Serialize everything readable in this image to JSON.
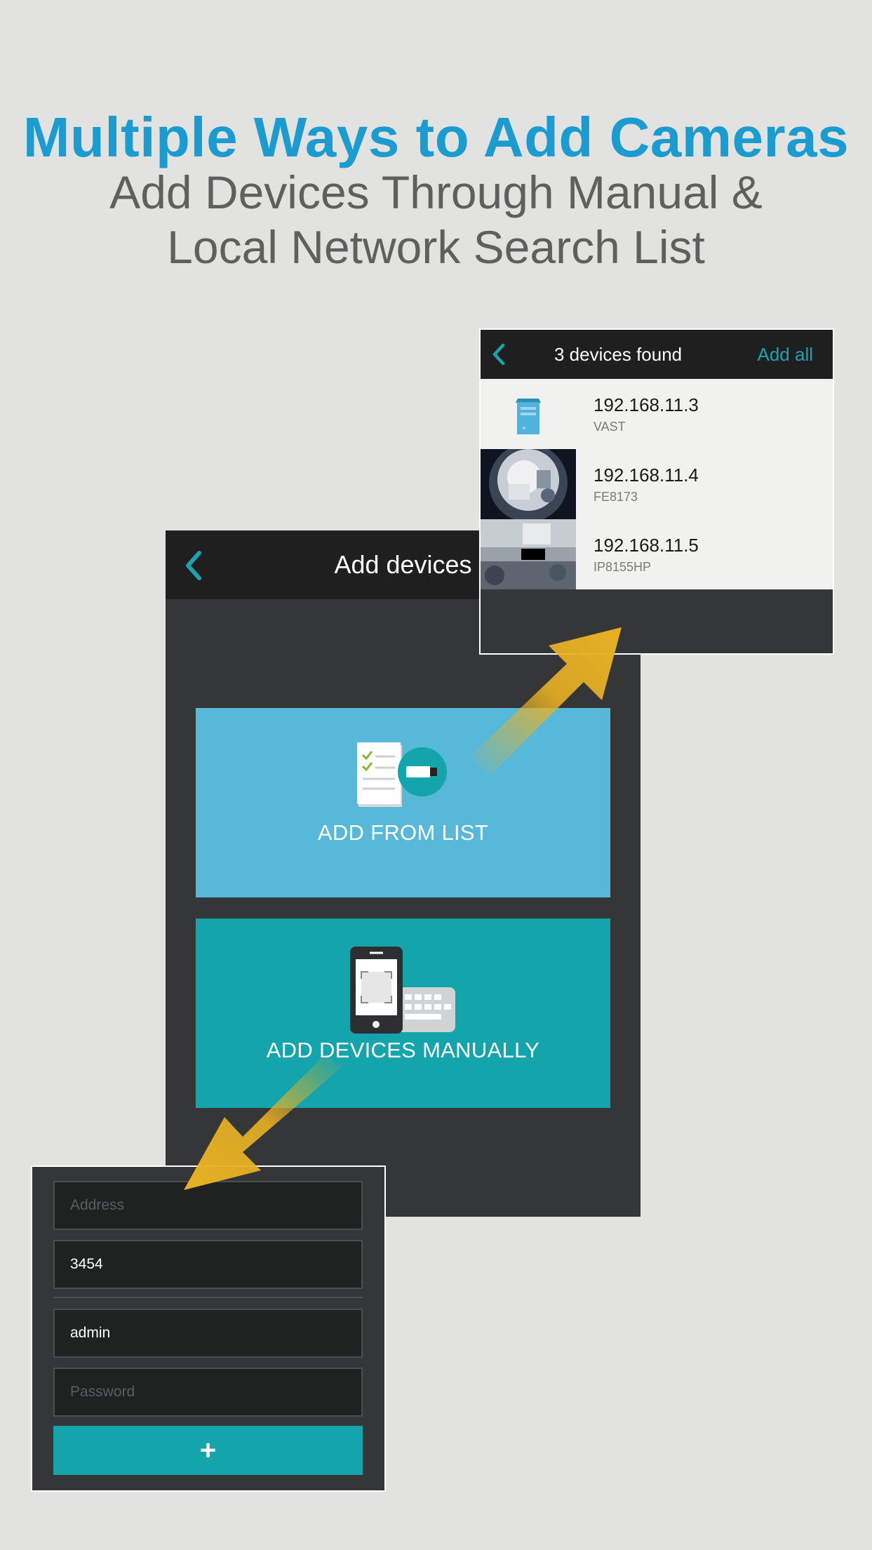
{
  "headline": "Multiple Ways to Add Cameras",
  "subheadline": {
    "line1": "Add Devices Through Manual &",
    "line2": "Local Network Search List"
  },
  "main_screen": {
    "title": "Add devices",
    "back_icon": "chevron-left-icon",
    "options": [
      {
        "label": "ADD FROM LIST",
        "icon": "checklist-camera-icon",
        "color": "#57b8da"
      },
      {
        "label": "ADD DEVICES MANUALLY",
        "icon": "phone-keyboard-icon",
        "color": "#14a4ac"
      }
    ]
  },
  "search_screen": {
    "title": "3 devices found",
    "add_all_label": "Add all",
    "back_icon": "chevron-left-icon",
    "devices": [
      {
        "ip": "192.168.11.3",
        "model": "VAST",
        "thumb": "server-icon"
      },
      {
        "ip": "192.168.11.4",
        "model": "FE8173",
        "thumb": "fisheye-camera-thumbnail"
      },
      {
        "ip": "192.168.11.5",
        "model": "IP8155HP",
        "thumb": "camera-thumbnail"
      }
    ]
  },
  "manual_form": {
    "address_placeholder": "Address",
    "port_value": "3454",
    "username_value": "admin",
    "password_placeholder": "Password",
    "submit_icon": "plus-icon",
    "submit_label": "+"
  },
  "colors": {
    "accent_blue": "#1a9cd0",
    "teal": "#14a4ac",
    "arrow_yellow": "#e8b124",
    "panel_dark": "#353638"
  }
}
